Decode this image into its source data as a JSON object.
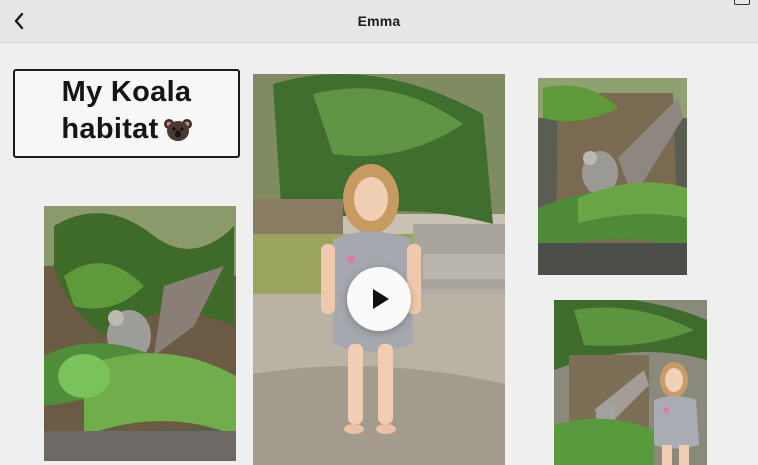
{
  "nav": {
    "title": "Emma",
    "back_icon": "chevron-left-icon"
  },
  "title_card": {
    "line1": "My Koala",
    "line2": "habitat",
    "emoji_icon": "koala-face-icon"
  },
  "media": [
    {
      "name": "koala-habitat-photo-1",
      "kind": "photo"
    },
    {
      "name": "girl-standing-video",
      "kind": "video",
      "control_icon": "play-icon"
    },
    {
      "name": "koala-habitat-photo-2",
      "kind": "photo"
    },
    {
      "name": "girl-with-habitat-photo",
      "kind": "photo"
    }
  ],
  "colors": {
    "background": "#efeff0",
    "navbar": "#e6e6e8",
    "card_border": "#1b1b1b"
  }
}
